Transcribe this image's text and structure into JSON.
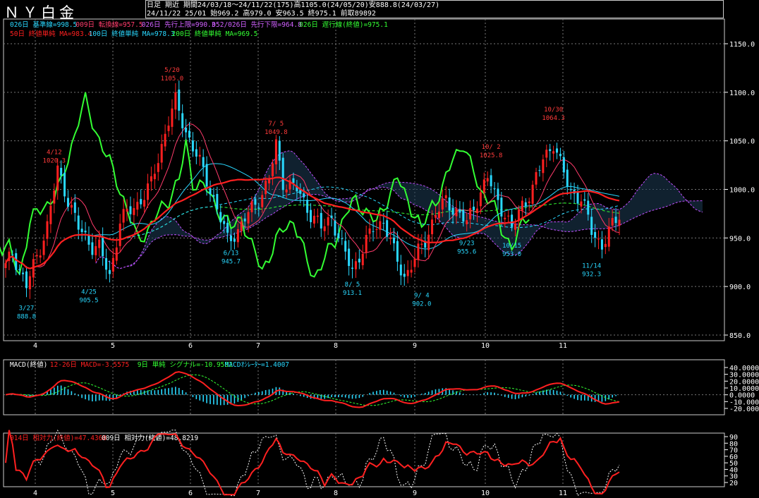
{
  "header": {
    "title": "ＮＹ白金",
    "line1": "日足  期近  期間24/03/18～24/11/22(175)高1105.0(24/05/20)安888.8(24/03/27)",
    "line2": "24/11/22 25/01 始969.2 高979.0 安963.5 終975.1 前取89892"
  },
  "legend_row1": [
    {
      "text": "026日 基準線=998.5",
      "color": "#29d8ff"
    },
    {
      "text": "009日 転換線=957.5",
      "color": "#ff3b6b"
    },
    {
      "text": "026日 先行上限=990.3",
      "color": "#d060ff"
    },
    {
      "text": "052/026日 先行下限=964.8",
      "color": "#d060ff"
    },
    {
      "text": "026日 遅行線(終値)=975.1",
      "color": "#33ff33"
    }
  ],
  "legend_row2": [
    {
      "text": "50日 終値単純 MA=983.4",
      "color": "#ff2020"
    },
    {
      "text": "100日 終値単純 MA=978.3",
      "color": "#29d8ff"
    },
    {
      "text": "200日 終値単純 MA=969.5",
      "color": "#33ff33"
    }
  ],
  "macd_legend": [
    {
      "text": "MACD(終値)",
      "color": "#ffffff"
    },
    {
      "text": "12-26日 MACD=-3.5575",
      "color": "#ff2020"
    },
    {
      "text": "9日 単純 シグナル=-10.9582",
      "color": "#33ff33"
    },
    {
      "text": "MACDｵｼﾚｰﾀｰ=1.4007",
      "color": "#29d8ff"
    }
  ],
  "rsi_legend": [
    {
      "text": "014日 相対力(終値)=47.4368",
      "color": "#ff2020"
    },
    {
      "text": "009日 相対力(終値)=48.8219",
      "color": "#ffffff"
    }
  ],
  "colors": {
    "up": "#ff2020",
    "down": "#29d8ff",
    "grid": "#777777",
    "axis": "#ffffff"
  },
  "chart_data": {
    "type": "candlestick",
    "x_months": [
      "4",
      "5",
      "6",
      "7",
      "8",
      "9",
      "10",
      "11"
    ],
    "price_axis": {
      "ticks": [
        "1150.0",
        "1100.0",
        "1050.0",
        "1000.0",
        "950.0",
        "900.0",
        "850.0"
      ],
      "ylim": [
        850,
        1160
      ]
    },
    "macd_axis": {
      "ticks": [
        "40.0000",
        "30.0000",
        "20.0000",
        "10.0000",
        "0.0000",
        "-10.0000",
        "-20.0000"
      ],
      "ylim": [
        -20,
        42
      ]
    },
    "rsi_axis": {
      "ticks": [
        "90",
        "80",
        "70",
        "60",
        "50",
        "40",
        "30",
        "20"
      ],
      "ylim": [
        20,
        90
      ]
    },
    "price_anchors": [
      [
        0,
        920
      ],
      [
        2,
        935
      ],
      [
        6,
        900
      ],
      [
        12,
        962
      ],
      [
        15,
        1020
      ],
      [
        21,
        960
      ],
      [
        25,
        942
      ],
      [
        27,
        940
      ],
      [
        30,
        910
      ],
      [
        33,
        968
      ],
      [
        38,
        985
      ],
      [
        42,
        1005
      ],
      [
        47,
        1072
      ],
      [
        49,
        1090
      ],
      [
        52,
        1060
      ],
      [
        55,
        1035
      ],
      [
        58,
        1010
      ],
      [
        61,
        980
      ],
      [
        64,
        948
      ],
      [
        67,
        958
      ],
      [
        70,
        975
      ],
      [
        73,
        990
      ],
      [
        76,
        1010
      ],
      [
        78,
        1046
      ],
      [
        80,
        1008
      ],
      [
        84,
        1000
      ],
      [
        88,
        975
      ],
      [
        91,
        960
      ],
      [
        94,
        972
      ],
      [
        97,
        940
      ],
      [
        100,
        918
      ],
      [
        103,
        938
      ],
      [
        106,
        960
      ],
      [
        109,
        968
      ],
      [
        112,
        935
      ],
      [
        115,
        910
      ],
      [
        118,
        928
      ],
      [
        121,
        948
      ],
      [
        124,
        975
      ],
      [
        127,
        988
      ],
      [
        130,
        978
      ],
      [
        133,
        965
      ],
      [
        136,
        990
      ],
      [
        139,
        1012
      ],
      [
        141,
        995
      ],
      [
        144,
        975
      ],
      [
        146,
        958
      ],
      [
        149,
        985
      ],
      [
        152,
        1000
      ],
      [
        155,
        1032
      ],
      [
        158,
        1048
      ],
      [
        160,
        1025
      ],
      [
        163,
        998
      ],
      [
        166,
        990
      ],
      [
        169,
        958
      ],
      [
        172,
        942
      ],
      [
        175,
        962
      ],
      [
        177,
        975
      ]
    ],
    "annotations": [
      {
        "text": "3/27",
        "sub": "888.8",
        "i": 6,
        "price": 888.8,
        "pos": "below"
      },
      {
        "text": "4/12",
        "sub": "1020.3",
        "i": 14,
        "price": 1020.3,
        "pos": "above"
      },
      {
        "text": "4/25",
        "sub": "905.5",
        "i": 24,
        "price": 905.5,
        "pos": "below"
      },
      {
        "text": "5/20",
        "sub": "1105.0",
        "i": 48,
        "price": 1105.0,
        "pos": "above"
      },
      {
        "text": "6/13",
        "sub": "945.7",
        "i": 65,
        "price": 945.7,
        "pos": "below"
      },
      {
        "text": "7/ 5",
        "sub": "1049.8",
        "i": 78,
        "price": 1049.8,
        "pos": "above"
      },
      {
        "text": "8/ 5",
        "sub": "913.1",
        "i": 100,
        "price": 913.1,
        "pos": "below"
      },
      {
        "text": "9/ 4",
        "sub": "902.0",
        "i": 120,
        "price": 902.0,
        "pos": "below"
      },
      {
        "text": "9/23",
        "sub": "955.6",
        "i": 133,
        "price": 955.6,
        "pos": "below"
      },
      {
        "text": "10/ 2",
        "sub": "1025.8",
        "i": 140,
        "price": 1025.8,
        "pos": "above"
      },
      {
        "text": "10/15",
        "sub": "953.0",
        "i": 146,
        "price": 953.0,
        "pos": "below"
      },
      {
        "text": "10/30",
        "sub": "1064.3",
        "i": 158,
        "price": 1064.3,
        "pos": "above"
      },
      {
        "text": "11/14",
        "sub": "932.3",
        "i": 169,
        "price": 932.3,
        "pos": "below"
      }
    ]
  }
}
